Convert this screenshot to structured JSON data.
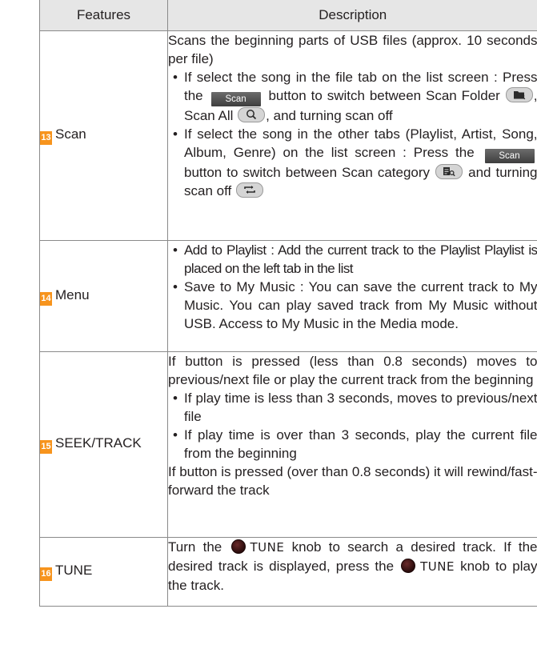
{
  "header": {
    "features": "Features",
    "description": "Description"
  },
  "rows": [
    {
      "num": "13",
      "feature": "Scan",
      "lines": {
        "intro": "Scans the beginning parts of USB files (approx. 10 seconds per file)",
        "b1_a": "If select the song in the file tab on the list screen : Press the",
        "b1_b": "button to switch between Scan Folder",
        "b1_c": ", Scan All",
        "b1_d": ", and turning scan off",
        "b2_a": "If select the song in the other tabs (Playlist, Artist, Song, Album, Genre) on the list screen : Press the",
        "b2_b": "button to switch between Scan category",
        "b2_c": "and turning scan off"
      },
      "scan_label": "Scan"
    },
    {
      "num": "14",
      "feature": "Menu",
      "lines": {
        "b1": "Add to Playlist : Add the current track to the Playlist Playlist is placed on the left tab in the list",
        "b2": "Save to My Music : You can save the current track to My Music. You can play saved track from My Music without USB.  Access to My Music in the Media mode."
      }
    },
    {
      "num": "15",
      "feature": "SEEK/TRACK",
      "lines": {
        "intro": "If button is pressed (less than 0.8 seconds) moves to previous/next file or play the current track from the beginning",
        "b1": "If play time is less than 3 seconds, moves to previous/next file",
        "b2": "If play time is over than 3 seconds, play the current file from the beginning",
        "outro": "If button is pressed (over than 0.8 seconds) it will rewind/fast-forward the track"
      }
    },
    {
      "num": "16",
      "feature": "TUNE",
      "lines": {
        "a": "Turn the",
        "knob": "TUNE",
        "b": "knob to search a desired track. If the desired track is displayed, press the",
        "c": "knob to play the track."
      }
    }
  ],
  "bullet": "•",
  "colors": {
    "badge": "#f7941d",
    "header_bg": "#e6e6e6",
    "border": "#8a8a8a"
  },
  "icons": [
    "scan-folder-icon",
    "scan-all-icon",
    "scan-category-icon",
    "scan-off-icon",
    "tune-knob-icon"
  ]
}
